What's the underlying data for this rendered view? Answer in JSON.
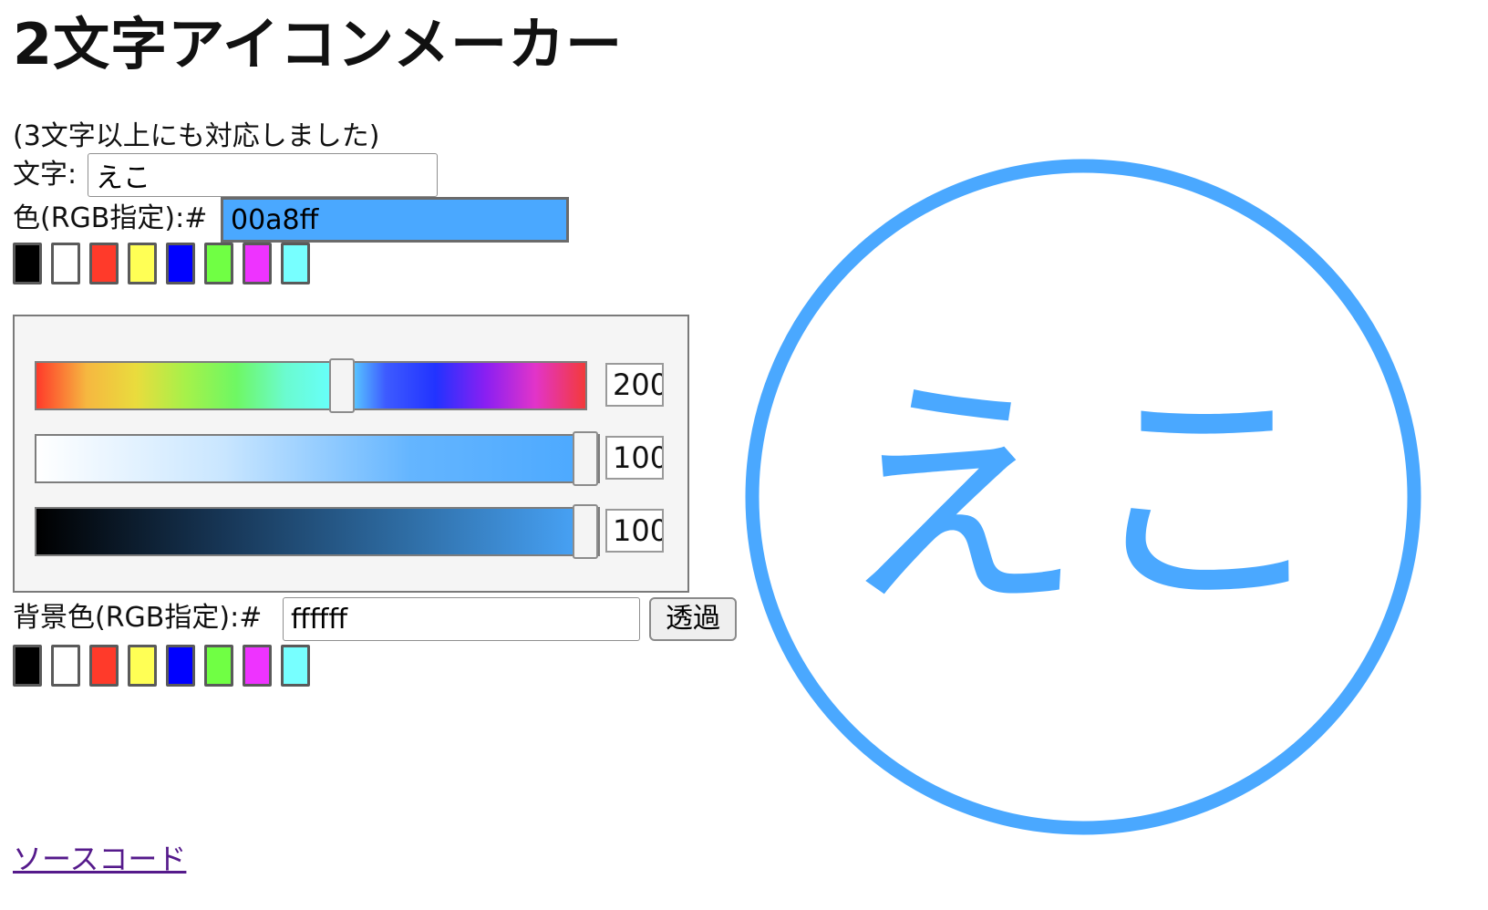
{
  "page": {
    "title": "2文字アイコンメーカー",
    "note": "(3文字以上にも対応しました)"
  },
  "form": {
    "text_label": "文字:",
    "text_value": "えこ",
    "color_label": "色(RGB指定):#",
    "color_value": "00a8ff",
    "bg_label": "背景色(RGB指定):#",
    "bg_value": "ffffff",
    "transparent_button": "透過"
  },
  "palette": {
    "swatches": [
      "#000000",
      "#ffffff",
      "#ff3a2a",
      "#ffff55",
      "#0000ff",
      "#70ff44",
      "#ee33ff",
      "#77ffff"
    ]
  },
  "sliders": {
    "hue_value": "200",
    "hue_fraction": 0.56,
    "saturation_value": "100",
    "saturation_fraction": 1.0,
    "brightness_value": "100",
    "brightness_fraction": 1.0
  },
  "preview": {
    "text": "えこ",
    "color": "#4aa8ff",
    "background": "#ffffff"
  },
  "footer": {
    "source_link": "ソースコード"
  }
}
